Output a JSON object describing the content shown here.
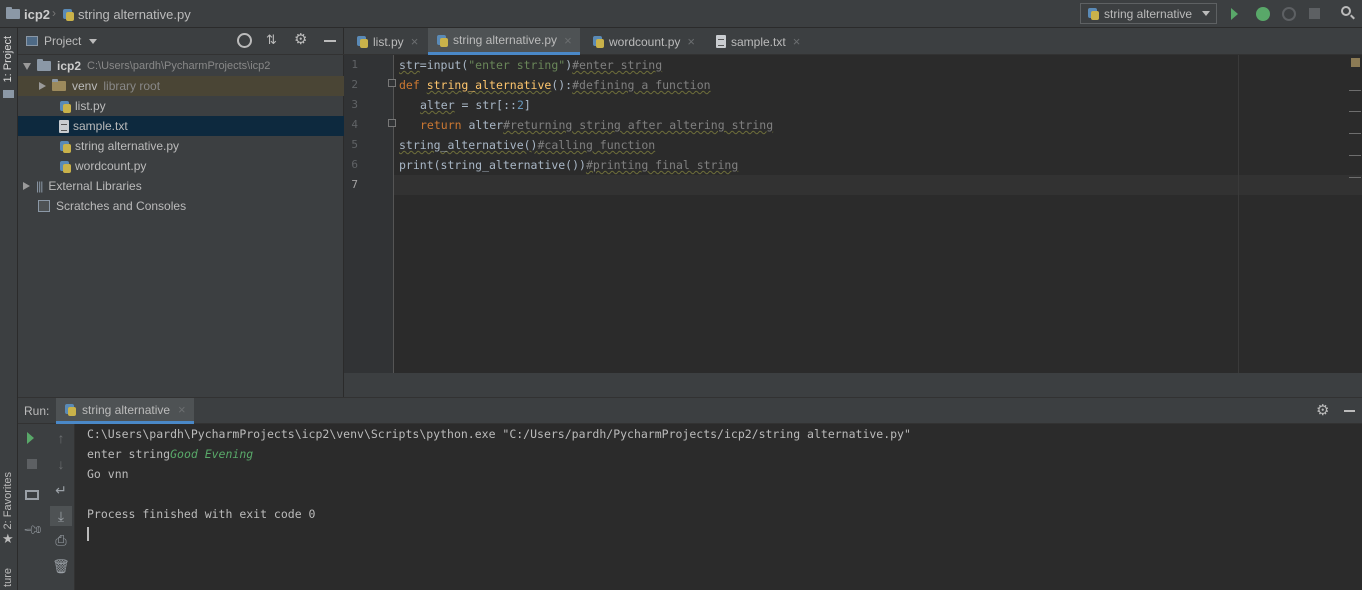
{
  "navbar": {
    "project": "icp2",
    "file": "string alternative.py",
    "run_config": "string alternative"
  },
  "left_strip": {
    "project_label": "1: Project",
    "favorites_label": "2: Favorites",
    "structure_label": "ture"
  },
  "project_panel": {
    "title": "Project",
    "tree": [
      {
        "name": "icp2",
        "path": "C:\\Users\\pardh\\PycharmProjects\\icp2"
      },
      {
        "name": "venv",
        "note": "library root"
      },
      {
        "name": "list.py"
      },
      {
        "name": "sample.txt"
      },
      {
        "name": "string alternative.py"
      },
      {
        "name": "wordcount.py"
      },
      {
        "name": "External Libraries"
      },
      {
        "name": "Scratches and Consoles"
      }
    ]
  },
  "editor_tabs": [
    "list.py",
    "string alternative.py",
    "wordcount.py",
    "sample.txt"
  ],
  "editor": {
    "line_numbers": [
      "1",
      "2",
      "3",
      "4",
      "5",
      "6",
      "7"
    ],
    "lines": {
      "l1_a": "str",
      "l1_b": "=input(",
      "l1_c": "\"enter string\"",
      "l1_d": ")",
      "l1_e": "#enter string",
      "l2_a": "def ",
      "l2_b": "string_alternative",
      "l2_c": "():",
      "l2_d": "#defining a function",
      "l3_a": "alter",
      "l3_b": " = str[::",
      "l3_c": "2",
      "l3_d": "]",
      "l4_a": "return ",
      "l4_b": "alter",
      "l4_c": "#returning string after altering string",
      "l5_a": "string_alternative()",
      "l5_b": "#calling function",
      "l6_a": "print(string_alternative())",
      "l6_b": "#printing final string"
    }
  },
  "run_panel": {
    "label": "Run:",
    "tab": "string alternative",
    "console": {
      "cmd": "C:\\Users\\pardh\\PycharmProjects\\icp2\\venv\\Scripts\\python.exe \"C:/Users/pardh/PycharmProjects/icp2/string alternative.py\"",
      "prompt": "enter string",
      "input": "Good Evening",
      "output": "Go vnn",
      "exit": "Process finished with exit code 0"
    }
  },
  "colors": {
    "background": "#2b2b2b",
    "panel": "#3c3f41",
    "keyword": "#cc7832",
    "string": "#6a8759",
    "comment": "#808080",
    "selection": "#0d293e",
    "run_green": "#59a869"
  }
}
